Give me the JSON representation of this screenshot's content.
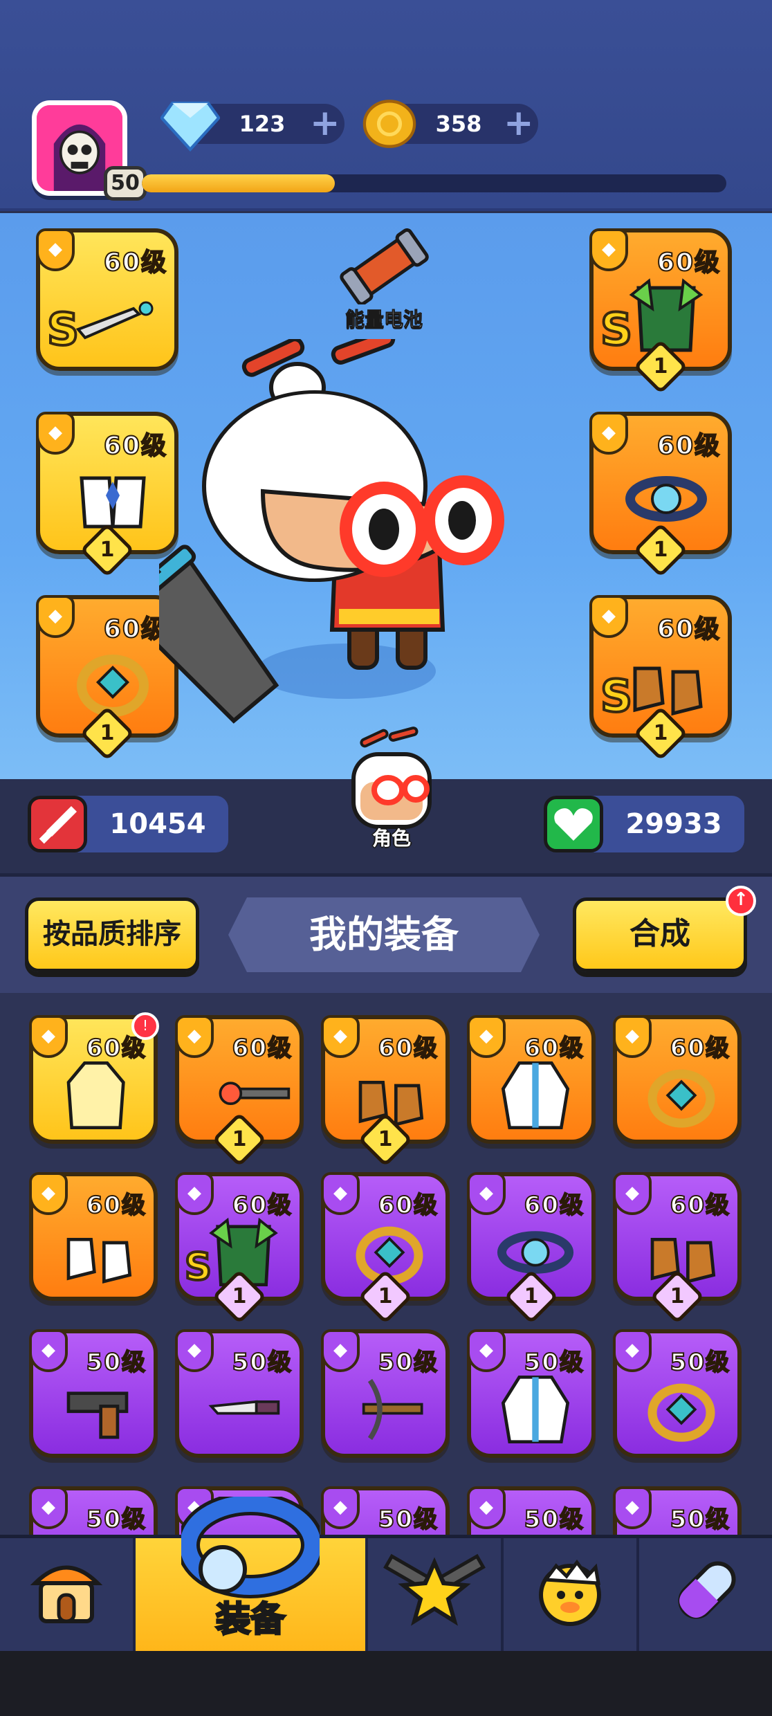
{
  "header": {
    "player_level": "50",
    "xp_progress": 0.33,
    "gems": "123",
    "coins": "358"
  },
  "hero": {
    "battery_label": "能量电池",
    "role_label": "角色",
    "attack": "10454",
    "health": "29933",
    "equipped": [
      {
        "id": "weapon",
        "level": "60级",
        "tier": "gold",
        "grade": "S",
        "stars": ""
      },
      {
        "id": "armor",
        "level": "60级",
        "tier": "orange",
        "grade": "S",
        "stars": "1"
      },
      {
        "id": "gloves",
        "level": "60级",
        "tier": "gold",
        "grade": "",
        "stars": "1"
      },
      {
        "id": "belt",
        "level": "60级",
        "tier": "orange",
        "grade": "",
        "stars": "1"
      },
      {
        "id": "ring",
        "level": "60级",
        "tier": "orange",
        "grade": "",
        "stars": "1"
      },
      {
        "id": "boots",
        "level": "60级",
        "tier": "orange",
        "grade": "S",
        "stars": "1"
      }
    ]
  },
  "inventory": {
    "sort_label": "按品质排序",
    "title": "我的装备",
    "merge_label": "合成",
    "items": [
      {
        "level": "60级",
        "tier": "gold",
        "grade": "",
        "stars": "",
        "icon": "coat-icon",
        "new": true
      },
      {
        "level": "60级",
        "tier": "orange",
        "grade": "",
        "stars": "1",
        "icon": "wand-icon"
      },
      {
        "level": "60级",
        "tier": "orange",
        "grade": "",
        "stars": "1",
        "icon": "boots-icon"
      },
      {
        "level": "60级",
        "tier": "orange",
        "grade": "",
        "stars": "",
        "icon": "robe-icon"
      },
      {
        "level": "60级",
        "tier": "orange",
        "grade": "",
        "stars": "",
        "icon": "ring-icon"
      },
      {
        "level": "60级",
        "tier": "orange",
        "grade": "",
        "stars": "",
        "icon": "white-boots-icon"
      },
      {
        "level": "60级",
        "tier": "purple",
        "grade": "S",
        "stars": "1",
        "icon": "armor-icon"
      },
      {
        "level": "60级",
        "tier": "purple",
        "grade": "",
        "stars": "1",
        "icon": "ring-icon"
      },
      {
        "level": "60级",
        "tier": "purple",
        "grade": "",
        "stars": "1",
        "icon": "belt-icon"
      },
      {
        "level": "60级",
        "tier": "purple",
        "grade": "",
        "stars": "1",
        "icon": "boots-icon"
      },
      {
        "level": "50级",
        "tier": "purple",
        "grade": "",
        "stars": "",
        "icon": "pistol-icon"
      },
      {
        "level": "50级",
        "tier": "purple",
        "grade": "",
        "stars": "",
        "icon": "knife-icon"
      },
      {
        "level": "50级",
        "tier": "purple",
        "grade": "",
        "stars": "",
        "icon": "crossbow-icon"
      },
      {
        "level": "50级",
        "tier": "purple",
        "grade": "",
        "stars": "",
        "icon": "robe-icon"
      },
      {
        "level": "50级",
        "tier": "purple",
        "grade": "",
        "stars": "",
        "icon": "ring-icon"
      },
      {
        "level": "50级",
        "tier": "purple",
        "grade": "",
        "stars": "",
        "icon": "ring-icon"
      },
      {
        "level": "",
        "tier": "purple",
        "grade": "",
        "stars": "",
        "icon": "belt-icon"
      },
      {
        "level": "50级",
        "tier": "purple",
        "grade": "",
        "stars": "",
        "icon": "belt-icon"
      },
      {
        "level": "50级",
        "tier": "purple",
        "grade": "",
        "stars": "",
        "icon": "ring-icon"
      },
      {
        "level": "50级",
        "tier": "purple",
        "grade": "",
        "stars": "",
        "icon": "ring-icon"
      }
    ]
  },
  "nav": {
    "active_label": "装备"
  },
  "colors": {
    "gold": "#ffc41a",
    "orange": "#ff7d10",
    "purple": "#8a2de0"
  }
}
